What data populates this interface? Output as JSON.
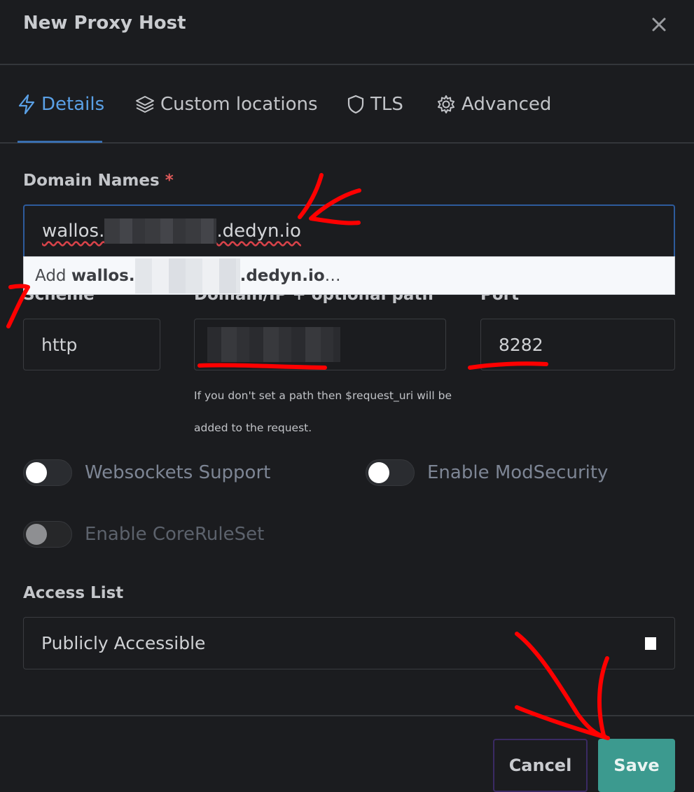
{
  "modal": {
    "title": "New Proxy Host"
  },
  "tabs": [
    {
      "label": "Details",
      "active": true,
      "icon": "bolt-icon"
    },
    {
      "label": "Custom locations",
      "active": false,
      "icon": "layers-icon"
    },
    {
      "label": "TLS",
      "active": false,
      "icon": "shield-icon"
    },
    {
      "label": "Advanced",
      "active": false,
      "icon": "gear-icon"
    }
  ],
  "domain": {
    "label": "Domain Names",
    "required_mark": "*",
    "value_prefix": "wallos.",
    "value_suffix": ".dedyn.io",
    "suggestion_prefix": "Add",
    "suggestion_value_prefix": "wallos.",
    "suggestion_value_suffix": ".dedyn.io",
    "suggestion_ellipsis": "…"
  },
  "forward": {
    "scheme_label": "Scheme",
    "scheme_value": "http",
    "host_label": "Domain/IP + optional path",
    "port_label": "Port",
    "port_value": "8282",
    "help_text": "If you don't set a path then $request_uri will be added to the request."
  },
  "toggles": {
    "websockets": {
      "label": "Websockets Support",
      "on": false
    },
    "modsecurity": {
      "label": "Enable ModSecurity",
      "on": false
    },
    "corerule": {
      "label": "Enable CoreRuleSet",
      "on": false,
      "disabled": true
    }
  },
  "access": {
    "label": "Access List",
    "value": "Publicly Accessible"
  },
  "footer": {
    "cancel_label": "Cancel",
    "save_label": "Save"
  },
  "colors": {
    "accent": "#5aa0e6",
    "save": "#3c9a8f",
    "annotation": "#ff0000"
  }
}
